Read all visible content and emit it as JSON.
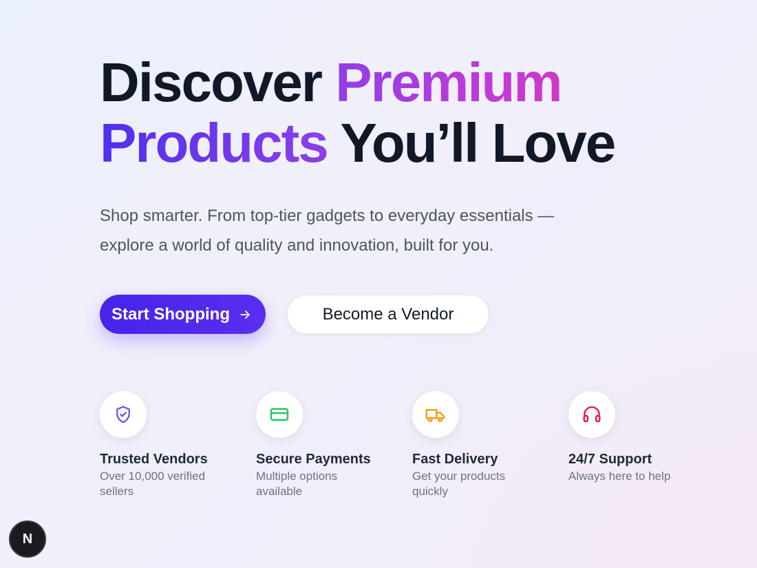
{
  "hero": {
    "headline": {
      "part1": "Discover ",
      "part2_gradient": "Premium",
      "part3_gradient": "Products",
      "part4": " You’ll Love"
    },
    "subtitle_line1": "Shop smarter. From top-tier gadgets to everyday essentials —",
    "subtitle_line2": "explore a world of quality and innovation, built for you."
  },
  "cta": {
    "primary_label": "Start Shopping",
    "primary_icon": "arrow-right-icon",
    "secondary_label": "Become a Vendor"
  },
  "features": [
    {
      "icon": "shield-check-icon",
      "icon_color": "#6d4aff",
      "title": "Trusted Vendors",
      "desc": "Over 10,000 verified sellers"
    },
    {
      "icon": "credit-card-icon",
      "icon_color": "#22c55e",
      "title": "Secure Payments",
      "desc": "Multiple options available"
    },
    {
      "icon": "truck-icon",
      "icon_color": "#f59e0b",
      "title": "Fast Delivery",
      "desc": "Get your products quickly"
    },
    {
      "icon": "headphones-icon",
      "icon_color": "#e11d48",
      "title": "24/7 Support",
      "desc": "Always here to help"
    }
  ],
  "dev_badge": {
    "label": "N"
  },
  "colors": {
    "primary": "#4f2ff0",
    "gradient_start": "#4f2ff0",
    "gradient_end": "#e9368f",
    "heading": "#111827",
    "body_text": "#4b5563"
  }
}
